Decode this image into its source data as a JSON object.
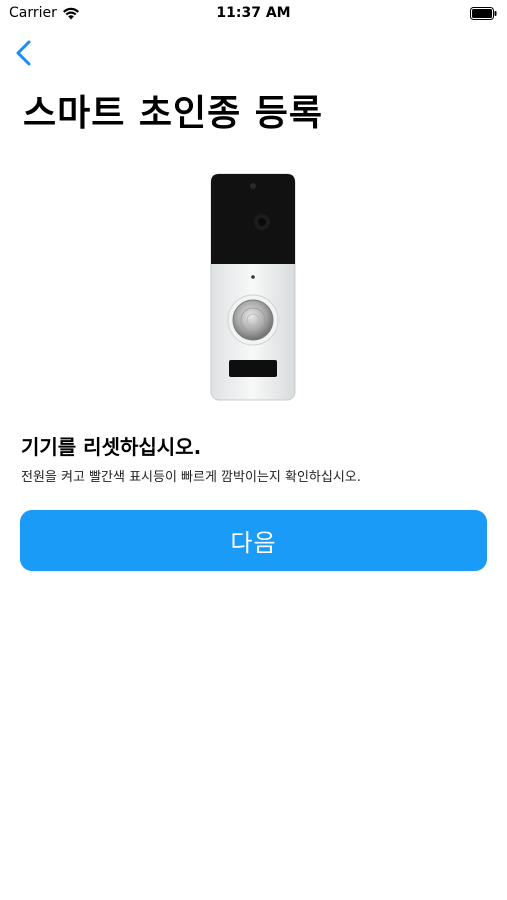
{
  "status_bar": {
    "carrier": "Carrier",
    "time": "11:37 AM"
  },
  "nav": {
    "back_icon": "chevron-left-icon"
  },
  "page": {
    "title": "스마트 초인종 등록"
  },
  "device": {
    "image": "doorbell-image"
  },
  "instruction": {
    "heading": "기기를 리셋하십시오.",
    "description": "전원을 켜고 빨간색 표시등이 빠르게 깜박이는지 확인하십시오."
  },
  "actions": {
    "next_label": "다음"
  },
  "colors": {
    "accent": "#1a9bf7",
    "back_chevron": "#1a8cf0"
  }
}
